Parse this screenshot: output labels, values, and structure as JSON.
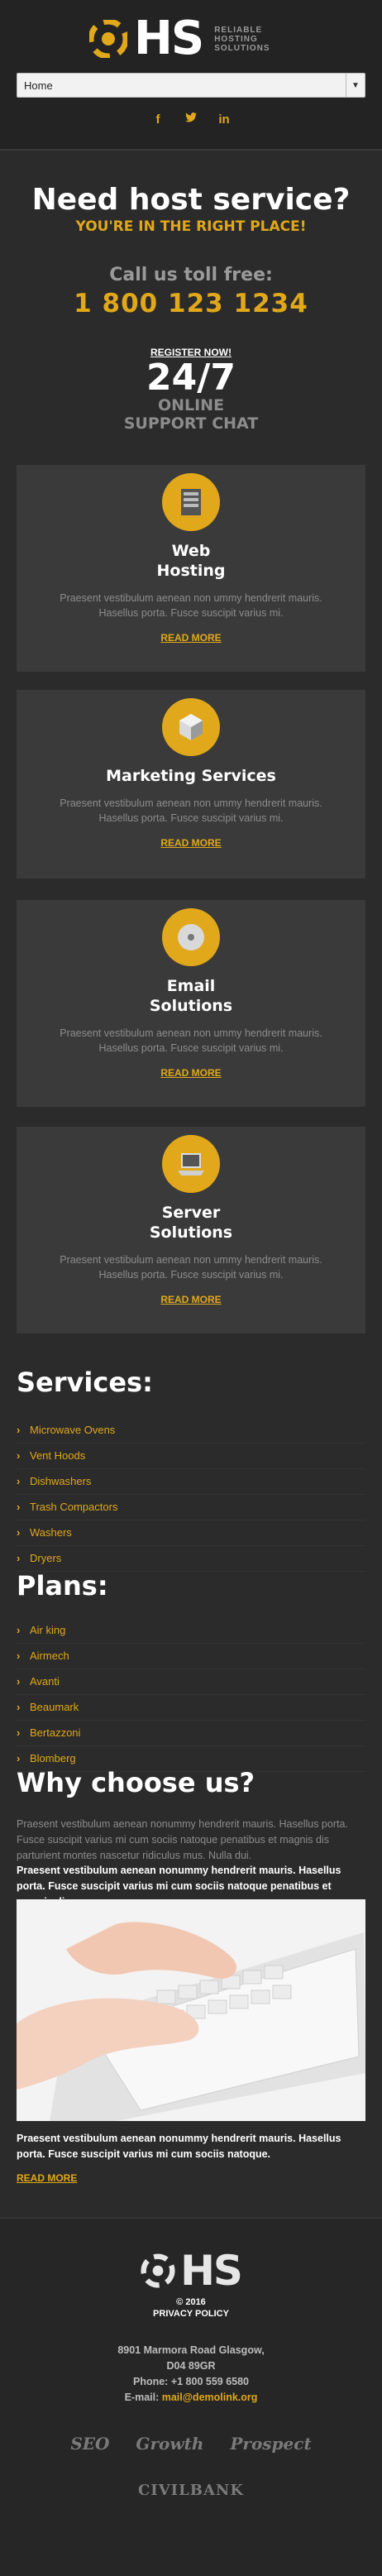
{
  "header": {
    "logo_text": "HS",
    "logo_tagline": [
      "RELIABLE",
      "HOSTING",
      "SOLUTIONS"
    ],
    "nav_selected": "Home",
    "social": [
      {
        "icon": "facebook-icon",
        "glyph": "f"
      },
      {
        "icon": "twitter-icon",
        "glyph": "t"
      },
      {
        "icon": "linkedin-icon",
        "glyph": "in"
      }
    ]
  },
  "hero": {
    "title": "Need host service?",
    "subtitle": "YOU'RE IN THE RIGHT PLACE!",
    "call_label": "Call us toll free:",
    "phone": "1 800 123 1234",
    "register": "REGISTER NOW!",
    "support_big": "24/7",
    "support_line1": "ONLINE",
    "support_line2": "SUPPORT CHAT"
  },
  "services_cards": [
    {
      "icon": "server-rack-icon",
      "title_l1": "Web",
      "title_l2": "Hosting",
      "text": "Praesent vestibulum aenean non ummy hendrerit mauris. Hasellus porta. Fusce suscipit varius mi.",
      "link": "READ MORE"
    },
    {
      "icon": "cube-icon",
      "title_l1": "Marketing Services",
      "title_l2": "",
      "text": "Praesent vestibulum aenean non ummy hendrerit mauris. Hasellus porta. Fusce suscipit varius mi.",
      "link": "READ MORE"
    },
    {
      "icon": "disc-icon",
      "title_l1": "Email",
      "title_l2": "Solutions",
      "text": "Praesent vestibulum aenean non ummy hendrerit mauris. Hasellus porta. Fusce suscipit varius mi.",
      "link": "READ MORE"
    },
    {
      "icon": "laptop-icon",
      "title_l1": "Server",
      "title_l2": "Solutions",
      "text": "Praesent vestibulum aenean non ummy hendrerit mauris. Hasellus porta. Fusce suscipit varius mi.",
      "link": "READ MORE"
    }
  ],
  "services_list": {
    "heading": "Services:",
    "items": [
      "Microwave Ovens",
      "Vent Hoods",
      "Dishwashers",
      "Trash Compactors",
      "Washers",
      "Dryers"
    ]
  },
  "plans_list": {
    "heading": "Plans:",
    "items": [
      "Air king",
      "Airmech",
      "Avanti",
      "Beaumark",
      "Bertazzoni",
      "Blomberg"
    ]
  },
  "why": {
    "heading": "Why choose us?",
    "para_muted": "Praesent vestibulum aenean nonummy hendrerit mauris. Hasellus porta. Fusce suscipit varius mi cum sociis natoque penatibus et magnis dis parturient montes nascetur ridiculus mus. Nulla dui.",
    "para_white": "Praesent vestibulum aenean nonummy hendrerit mauris. Hasellus porta. Fusce suscipit varius mi cum sociis natoque penatibus et magnis dis.",
    "para_white2": "Praesent vestibulum aenean nonummy hendrerit mauris. Hasellus porta. Fusce suscipit varius mi cum sociis natoque.",
    "read_more": "READ MORE"
  },
  "footer": {
    "logo_text": "HS",
    "copyright": "© 2016",
    "privacy": "PRIVACY POLICY",
    "address1": "8901 Marmora Road Glasgow,",
    "address2": "D04 89GR",
    "phone": "Phone: +1 800 559 6580",
    "email_label": "E-mail: ",
    "email": "mail@demolink.org",
    "partners": [
      "SEO",
      "Growth",
      "Prospect"
    ],
    "partner_bottom": "CIVILBANK"
  },
  "colors": {
    "accent": "#e0a81a",
    "bg": "#2b2b2b",
    "card": "#3a3a3a"
  }
}
